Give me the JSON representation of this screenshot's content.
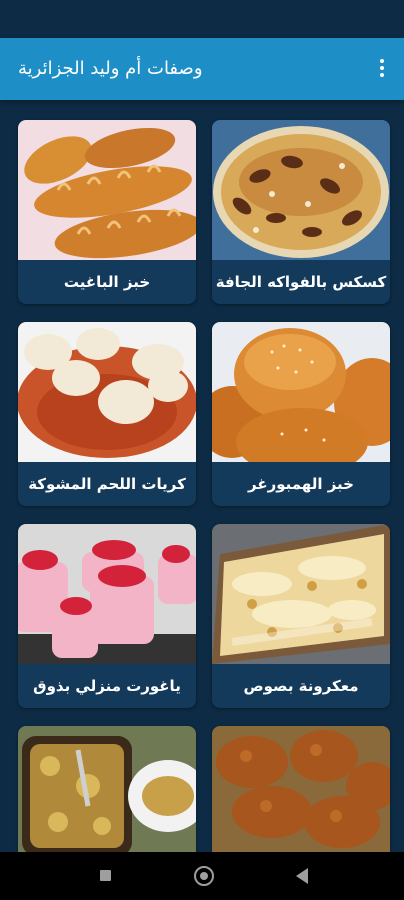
{
  "app_bar": {
    "title": "وصفات أم وليد الجزائرية",
    "background": "#1e8fc6",
    "menu_icon": "overflow-menu-icon"
  },
  "recipes": [
    {
      "label": "كسكس بالفواكه الجافة"
    },
    {
      "label": "خبز الباغيت"
    },
    {
      "label": "خبز الهمبورغر"
    },
    {
      "label": "كريات اللحم المشوكة"
    },
    {
      "label": "معكرونة بصوص"
    },
    {
      "label": "ياغورت منزلي بذوق"
    },
    {
      "label": ""
    },
    {
      "label": ""
    }
  ],
  "nav": {
    "recents_icon": "recents-square-icon",
    "home_icon": "home-circle-icon",
    "back_icon": "back-triangle-icon"
  },
  "colors": {
    "background": "#0d2b44",
    "card": "#133a5b",
    "label_text": "#ffffff"
  }
}
